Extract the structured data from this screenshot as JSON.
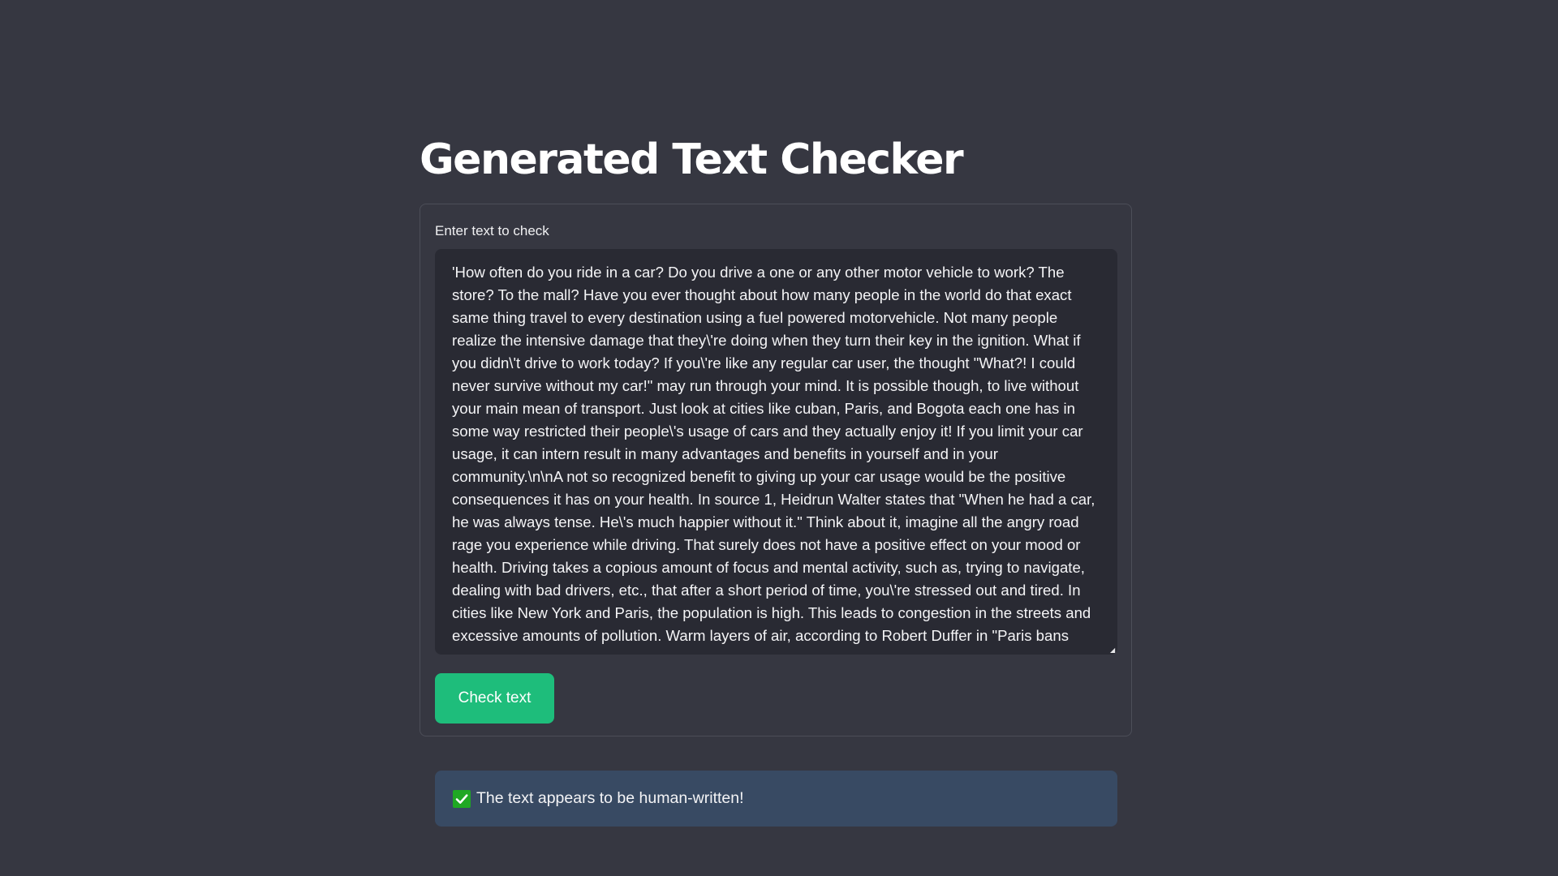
{
  "page": {
    "title": "Generated Text Checker"
  },
  "form": {
    "input_label": "Enter text to check",
    "input_value": "'How often do you ride in a car? Do you drive a one or any other motor vehicle to work? The store? To the mall? Have you ever thought about how many people in the world do that exact same thing travel to every destination using a fuel powered motorvehicle. Not many people realize the intensive damage that they\\'re doing when they turn their key in the ignition. What if you didn\\'t drive to work today? If you\\'re like any regular car user, the thought \"What?! I could never survive without my car!\" may run through your mind. It is possible though, to live without your main mean of transport. Just look at cities like cuban, Paris, and Bogota each one has in some way restricted their people\\'s usage of cars and they actually enjoy it! If you limit your car usage, it can intern result in many advantages and benefits in yourself and in your community.\\n\\nA not so recognized benefit to giving up your car usage would be the positive consequences it has on your health. In source 1, Heidrun Walter states that \"When he had a car, he was always tense. He\\'s much happier without it.\" Think about it, imagine all the angry road rage you experience while driving. That surely does not have a positive effect on your mood or health. Driving takes a copious amount of focus and mental activity, such as, trying to navigate, dealing with bad drivers, etc., that after a short period of time, you\\'re stressed out and tired. In cities like New York and Paris, the population is high. This leads to congestion in the streets and excessive amounts of pollution. Warm layers of air, according to Robert Duffer in \"Paris bans",
    "submit_label": "Check text"
  },
  "result": {
    "icon": "check-mark-icon",
    "message": "The text appears to be human-written!"
  },
  "colors": {
    "background": "#363741",
    "input_background": "#292a33",
    "button": "#1ebd7b",
    "result_background": "#384a63",
    "check_icon": "#1fa823"
  }
}
